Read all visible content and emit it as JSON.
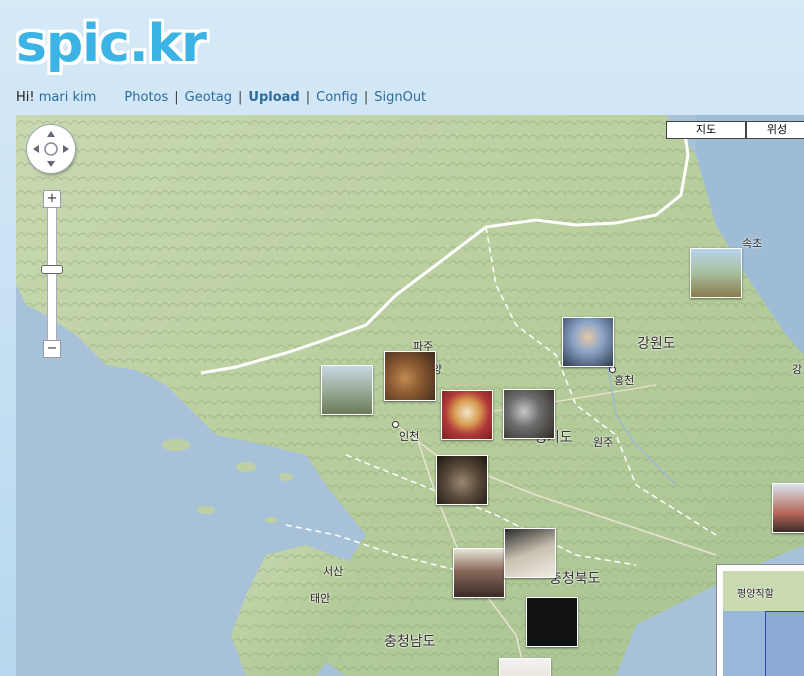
{
  "header": {
    "logo": "spic.kr",
    "greeting": "Hi!",
    "user_name": "mari kim",
    "nav": [
      {
        "label": "Photos",
        "bold": false
      },
      {
        "label": "Geotag",
        "bold": false
      },
      {
        "label": "Upload",
        "bold": true
      },
      {
        "label": "Config",
        "bold": false
      },
      {
        "label": "SignOut",
        "bold": false
      }
    ],
    "separator": "|"
  },
  "map": {
    "map_type_buttons": [
      "지도",
      "위성"
    ],
    "zoom_in": "+",
    "zoom_out": "−",
    "place_labels": {
      "paju": "파주",
      "yang": "양",
      "incheon": "인천",
      "suwon": "원주",
      "hongcheon": "홍천",
      "gangwon": "강원도",
      "sokcho": "속초",
      "gyeonggi": "경기도",
      "seosan": "서산",
      "taean": "태안",
      "chungbuk": "충청북도",
      "chungnam": "충청남도",
      "gang_edge": "강",
      "overview_label": "평양직할"
    },
    "photos": [
      "mountain-landscape",
      "food-plate",
      "noodle-bowl",
      "side-dish",
      "person-portrait",
      "mountain-hill",
      "meal-closeup",
      "restaurant-crowd",
      "dish-on-table",
      "dark-night",
      "person-bottom",
      "edge-photo"
    ]
  }
}
